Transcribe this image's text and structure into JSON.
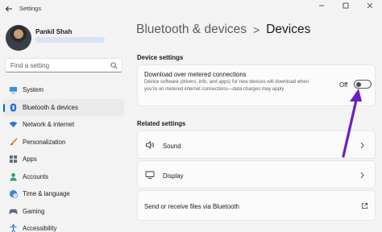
{
  "window": {
    "title": "Settings",
    "accent": "#0067c0",
    "arrow_color": "#6a1fc2"
  },
  "profile": {
    "name": "Pankil Shah"
  },
  "search": {
    "placeholder": "Find a setting"
  },
  "sidebar": {
    "items": [
      {
        "label": "System",
        "icon": "monitor-icon"
      },
      {
        "label": "Bluetooth & devices",
        "icon": "bluetooth-icon",
        "active": true
      },
      {
        "label": "Network & internet",
        "icon": "wifi-icon"
      },
      {
        "label": "Personalization",
        "icon": "brush-icon"
      },
      {
        "label": "Apps",
        "icon": "apps-icon"
      },
      {
        "label": "Accounts",
        "icon": "person-icon"
      },
      {
        "label": "Time & language",
        "icon": "globe-clock-icon"
      },
      {
        "label": "Gaming",
        "icon": "gamepad-icon"
      },
      {
        "label": "Accessibility",
        "icon": "accessibility-icon"
      }
    ]
  },
  "header": {
    "parent": "Bluetooth & devices",
    "separator": ">",
    "current": "Devices"
  },
  "device_settings": {
    "heading": "Device settings",
    "metered": {
      "title": "Download over metered connections",
      "description": "Device software (drivers, info, and apps) for new devices will download when you're on metered internet connections—data charges may apply",
      "state_label": "Off",
      "enabled": false
    }
  },
  "related_settings": {
    "heading": "Related settings",
    "items": [
      {
        "label": "Sound",
        "icon": "speaker-icon"
      },
      {
        "label": "Display",
        "icon": "display-icon"
      },
      {
        "label": "Send or receive files via Bluetooth",
        "icon": "external-link-icon"
      }
    ]
  }
}
